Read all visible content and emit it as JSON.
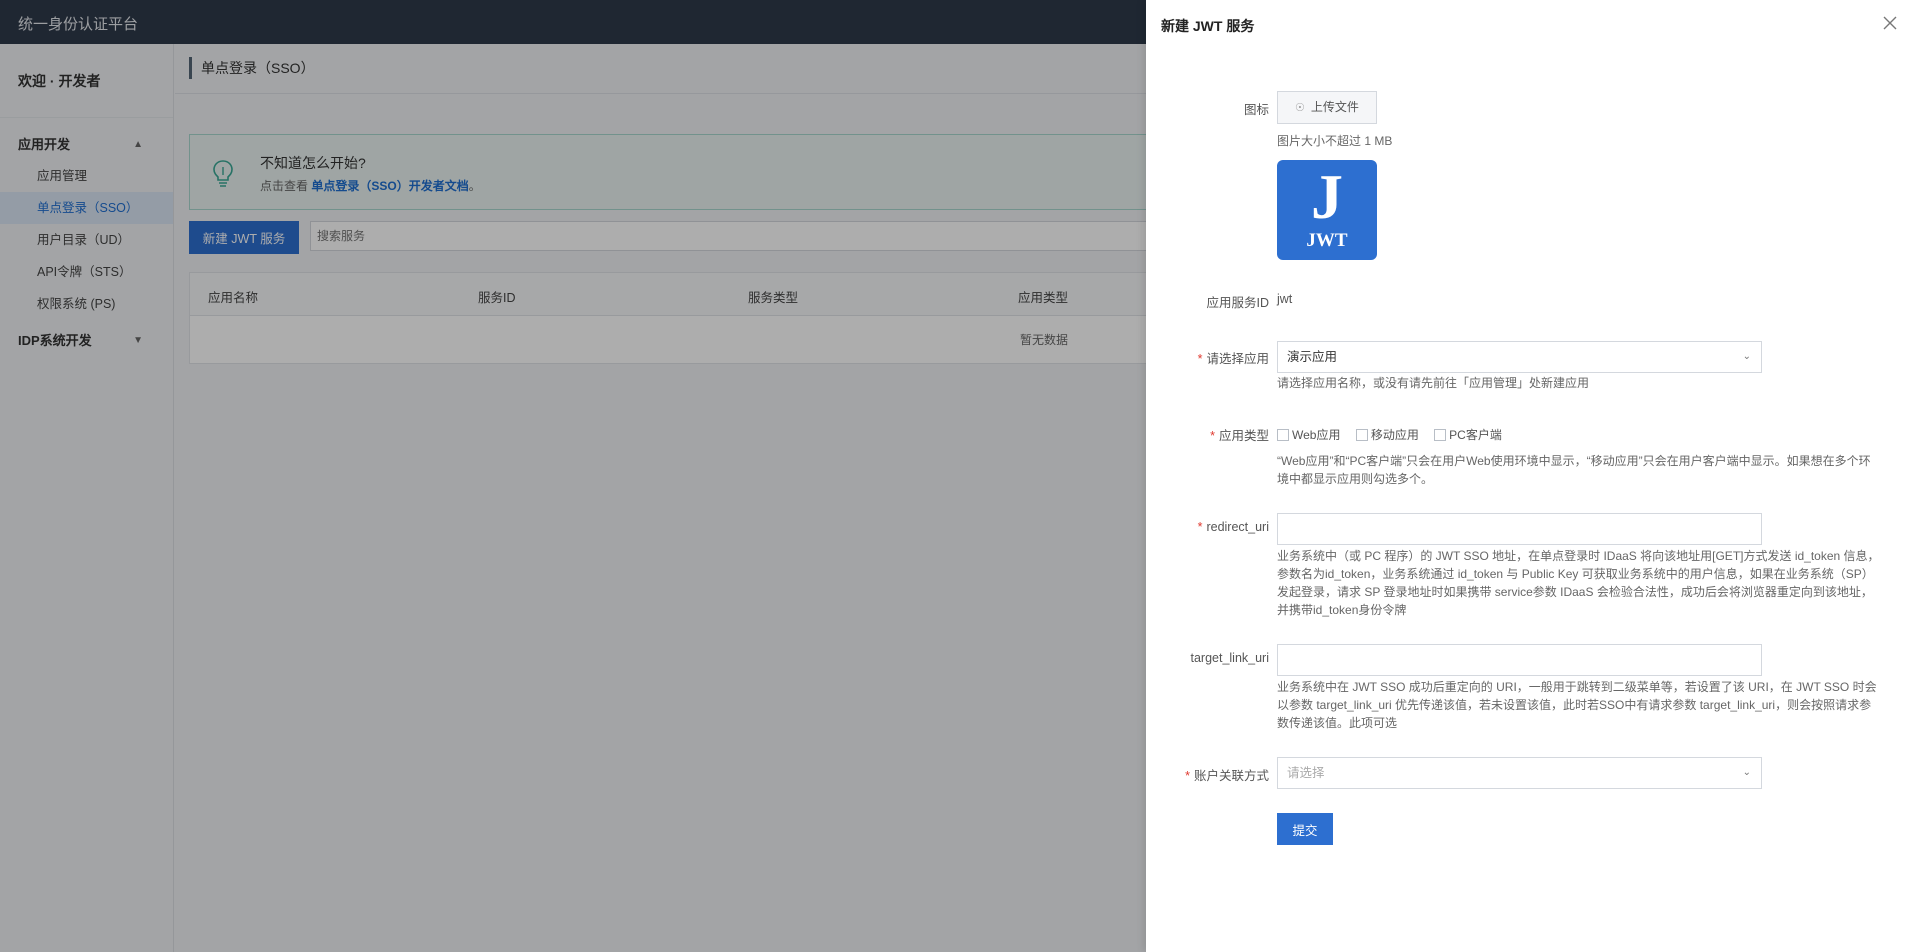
{
  "app": {
    "title": "统一身份认证平台"
  },
  "sidebar": {
    "welcome": "欢迎 · 开发者",
    "groups": [
      {
        "label": "应用开发",
        "chevron": "chevron-up-icon"
      },
      {
        "label": "IDP系统开发",
        "chevron": "chevron-down-icon"
      }
    ],
    "items": [
      {
        "label": "应用管理"
      },
      {
        "label": "单点登录（SSO）",
        "active": true
      },
      {
        "label": "用户目录（UD）"
      },
      {
        "label": "API令牌（STS）"
      },
      {
        "label": "权限系统 (PS)"
      }
    ]
  },
  "main": {
    "breadcrumb": "单点登录（SSO）",
    "tip": {
      "title": "不知道怎么开始?",
      "prefix": "点击查看",
      "link": "单点登录（SSO）开发者文档",
      "suffix": "。"
    },
    "new_button": "新建 JWT 服务",
    "search_placeholder": "搜索服务",
    "table": {
      "headers": [
        "应用名称",
        "服务ID",
        "服务类型",
        "应用类型"
      ],
      "empty": "暂无数据"
    }
  },
  "drawer": {
    "title": "新建 JWT 服务",
    "icon_label": "图标",
    "upload_label": "上传文件",
    "upload_hint": "图片大小不超过 1 MB",
    "logo": {
      "letter": "J",
      "text": "JWT",
      "color": "#2d6fd0"
    },
    "service_id_label": "应用服务ID",
    "service_id_value": "jwt",
    "app_label": "请选择应用",
    "app_value": "演示应用",
    "app_hint": "请选择应用名称，或没有请先前往「应用管理」处新建应用",
    "type_label": "应用类型",
    "type_options": [
      "Web应用",
      "移动应用",
      "PC客户端"
    ],
    "type_hint": "“Web应用”和“PC客户端”只会在用户Web使用环境中显示，“移动应用”只会在用户客户端中显示。如果想在多个环境中都显示应用则勾选多个。",
    "redirect_label": "redirect_uri",
    "redirect_hint": "业务系统中（或 PC 程序）的 JWT SSO 地址，在单点登录时 IDaaS 将向该地址用[GET]方式发送 id_token 信息，参数名为id_token，业务系统通过 id_token 与 Public Key 可获取业务系统中的用户信息，如果在业务系统（SP）发起登录，请求 SP 登录地址时如果携带 service参数 IDaaS 会检验合法性，成功后会将浏览器重定向到该地址，并携带id_token身份令牌",
    "target_label": "target_link_uri",
    "target_hint": "业务系统中在 JWT SSO 成功后重定向的 URI，一般用于跳转到二级菜单等，若设置了该 URI，在 JWT SSO 时会以参数 target_link_uri 优先传递该值，若未设置该值，此时若SSO中有请求参数 target_link_uri，则会按照请求参数传递该值。此项可选",
    "account_label": "账户关联方式",
    "account_placeholder": "请选择",
    "submit_label": "提交"
  }
}
